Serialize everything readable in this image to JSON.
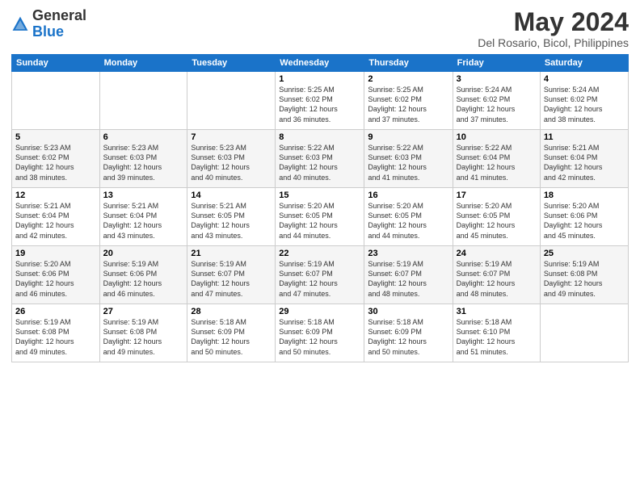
{
  "logo": {
    "general": "General",
    "blue": "Blue"
  },
  "header": {
    "title": "May 2024",
    "subtitle": "Del Rosario, Bicol, Philippines"
  },
  "weekdays": [
    "Sunday",
    "Monday",
    "Tuesday",
    "Wednesday",
    "Thursday",
    "Friday",
    "Saturday"
  ],
  "weeks": [
    [
      {
        "day": "",
        "info": ""
      },
      {
        "day": "",
        "info": ""
      },
      {
        "day": "",
        "info": ""
      },
      {
        "day": "1",
        "info": "Sunrise: 5:25 AM\nSunset: 6:02 PM\nDaylight: 12 hours\nand 36 minutes."
      },
      {
        "day": "2",
        "info": "Sunrise: 5:25 AM\nSunset: 6:02 PM\nDaylight: 12 hours\nand 37 minutes."
      },
      {
        "day": "3",
        "info": "Sunrise: 5:24 AM\nSunset: 6:02 PM\nDaylight: 12 hours\nand 37 minutes."
      },
      {
        "day": "4",
        "info": "Sunrise: 5:24 AM\nSunset: 6:02 PM\nDaylight: 12 hours\nand 38 minutes."
      }
    ],
    [
      {
        "day": "5",
        "info": "Sunrise: 5:23 AM\nSunset: 6:02 PM\nDaylight: 12 hours\nand 38 minutes."
      },
      {
        "day": "6",
        "info": "Sunrise: 5:23 AM\nSunset: 6:03 PM\nDaylight: 12 hours\nand 39 minutes."
      },
      {
        "day": "7",
        "info": "Sunrise: 5:23 AM\nSunset: 6:03 PM\nDaylight: 12 hours\nand 40 minutes."
      },
      {
        "day": "8",
        "info": "Sunrise: 5:22 AM\nSunset: 6:03 PM\nDaylight: 12 hours\nand 40 minutes."
      },
      {
        "day": "9",
        "info": "Sunrise: 5:22 AM\nSunset: 6:03 PM\nDaylight: 12 hours\nand 41 minutes."
      },
      {
        "day": "10",
        "info": "Sunrise: 5:22 AM\nSunset: 6:04 PM\nDaylight: 12 hours\nand 41 minutes."
      },
      {
        "day": "11",
        "info": "Sunrise: 5:21 AM\nSunset: 6:04 PM\nDaylight: 12 hours\nand 42 minutes."
      }
    ],
    [
      {
        "day": "12",
        "info": "Sunrise: 5:21 AM\nSunset: 6:04 PM\nDaylight: 12 hours\nand 42 minutes."
      },
      {
        "day": "13",
        "info": "Sunrise: 5:21 AM\nSunset: 6:04 PM\nDaylight: 12 hours\nand 43 minutes."
      },
      {
        "day": "14",
        "info": "Sunrise: 5:21 AM\nSunset: 6:05 PM\nDaylight: 12 hours\nand 43 minutes."
      },
      {
        "day": "15",
        "info": "Sunrise: 5:20 AM\nSunset: 6:05 PM\nDaylight: 12 hours\nand 44 minutes."
      },
      {
        "day": "16",
        "info": "Sunrise: 5:20 AM\nSunset: 6:05 PM\nDaylight: 12 hours\nand 44 minutes."
      },
      {
        "day": "17",
        "info": "Sunrise: 5:20 AM\nSunset: 6:05 PM\nDaylight: 12 hours\nand 45 minutes."
      },
      {
        "day": "18",
        "info": "Sunrise: 5:20 AM\nSunset: 6:06 PM\nDaylight: 12 hours\nand 45 minutes."
      }
    ],
    [
      {
        "day": "19",
        "info": "Sunrise: 5:20 AM\nSunset: 6:06 PM\nDaylight: 12 hours\nand 46 minutes."
      },
      {
        "day": "20",
        "info": "Sunrise: 5:19 AM\nSunset: 6:06 PM\nDaylight: 12 hours\nand 46 minutes."
      },
      {
        "day": "21",
        "info": "Sunrise: 5:19 AM\nSunset: 6:07 PM\nDaylight: 12 hours\nand 47 minutes."
      },
      {
        "day": "22",
        "info": "Sunrise: 5:19 AM\nSunset: 6:07 PM\nDaylight: 12 hours\nand 47 minutes."
      },
      {
        "day": "23",
        "info": "Sunrise: 5:19 AM\nSunset: 6:07 PM\nDaylight: 12 hours\nand 48 minutes."
      },
      {
        "day": "24",
        "info": "Sunrise: 5:19 AM\nSunset: 6:07 PM\nDaylight: 12 hours\nand 48 minutes."
      },
      {
        "day": "25",
        "info": "Sunrise: 5:19 AM\nSunset: 6:08 PM\nDaylight: 12 hours\nand 49 minutes."
      }
    ],
    [
      {
        "day": "26",
        "info": "Sunrise: 5:19 AM\nSunset: 6:08 PM\nDaylight: 12 hours\nand 49 minutes."
      },
      {
        "day": "27",
        "info": "Sunrise: 5:19 AM\nSunset: 6:08 PM\nDaylight: 12 hours\nand 49 minutes."
      },
      {
        "day": "28",
        "info": "Sunrise: 5:18 AM\nSunset: 6:09 PM\nDaylight: 12 hours\nand 50 minutes."
      },
      {
        "day": "29",
        "info": "Sunrise: 5:18 AM\nSunset: 6:09 PM\nDaylight: 12 hours\nand 50 minutes."
      },
      {
        "day": "30",
        "info": "Sunrise: 5:18 AM\nSunset: 6:09 PM\nDaylight: 12 hours\nand 50 minutes."
      },
      {
        "day": "31",
        "info": "Sunrise: 5:18 AM\nSunset: 6:10 PM\nDaylight: 12 hours\nand 51 minutes."
      },
      {
        "day": "",
        "info": ""
      }
    ]
  ]
}
